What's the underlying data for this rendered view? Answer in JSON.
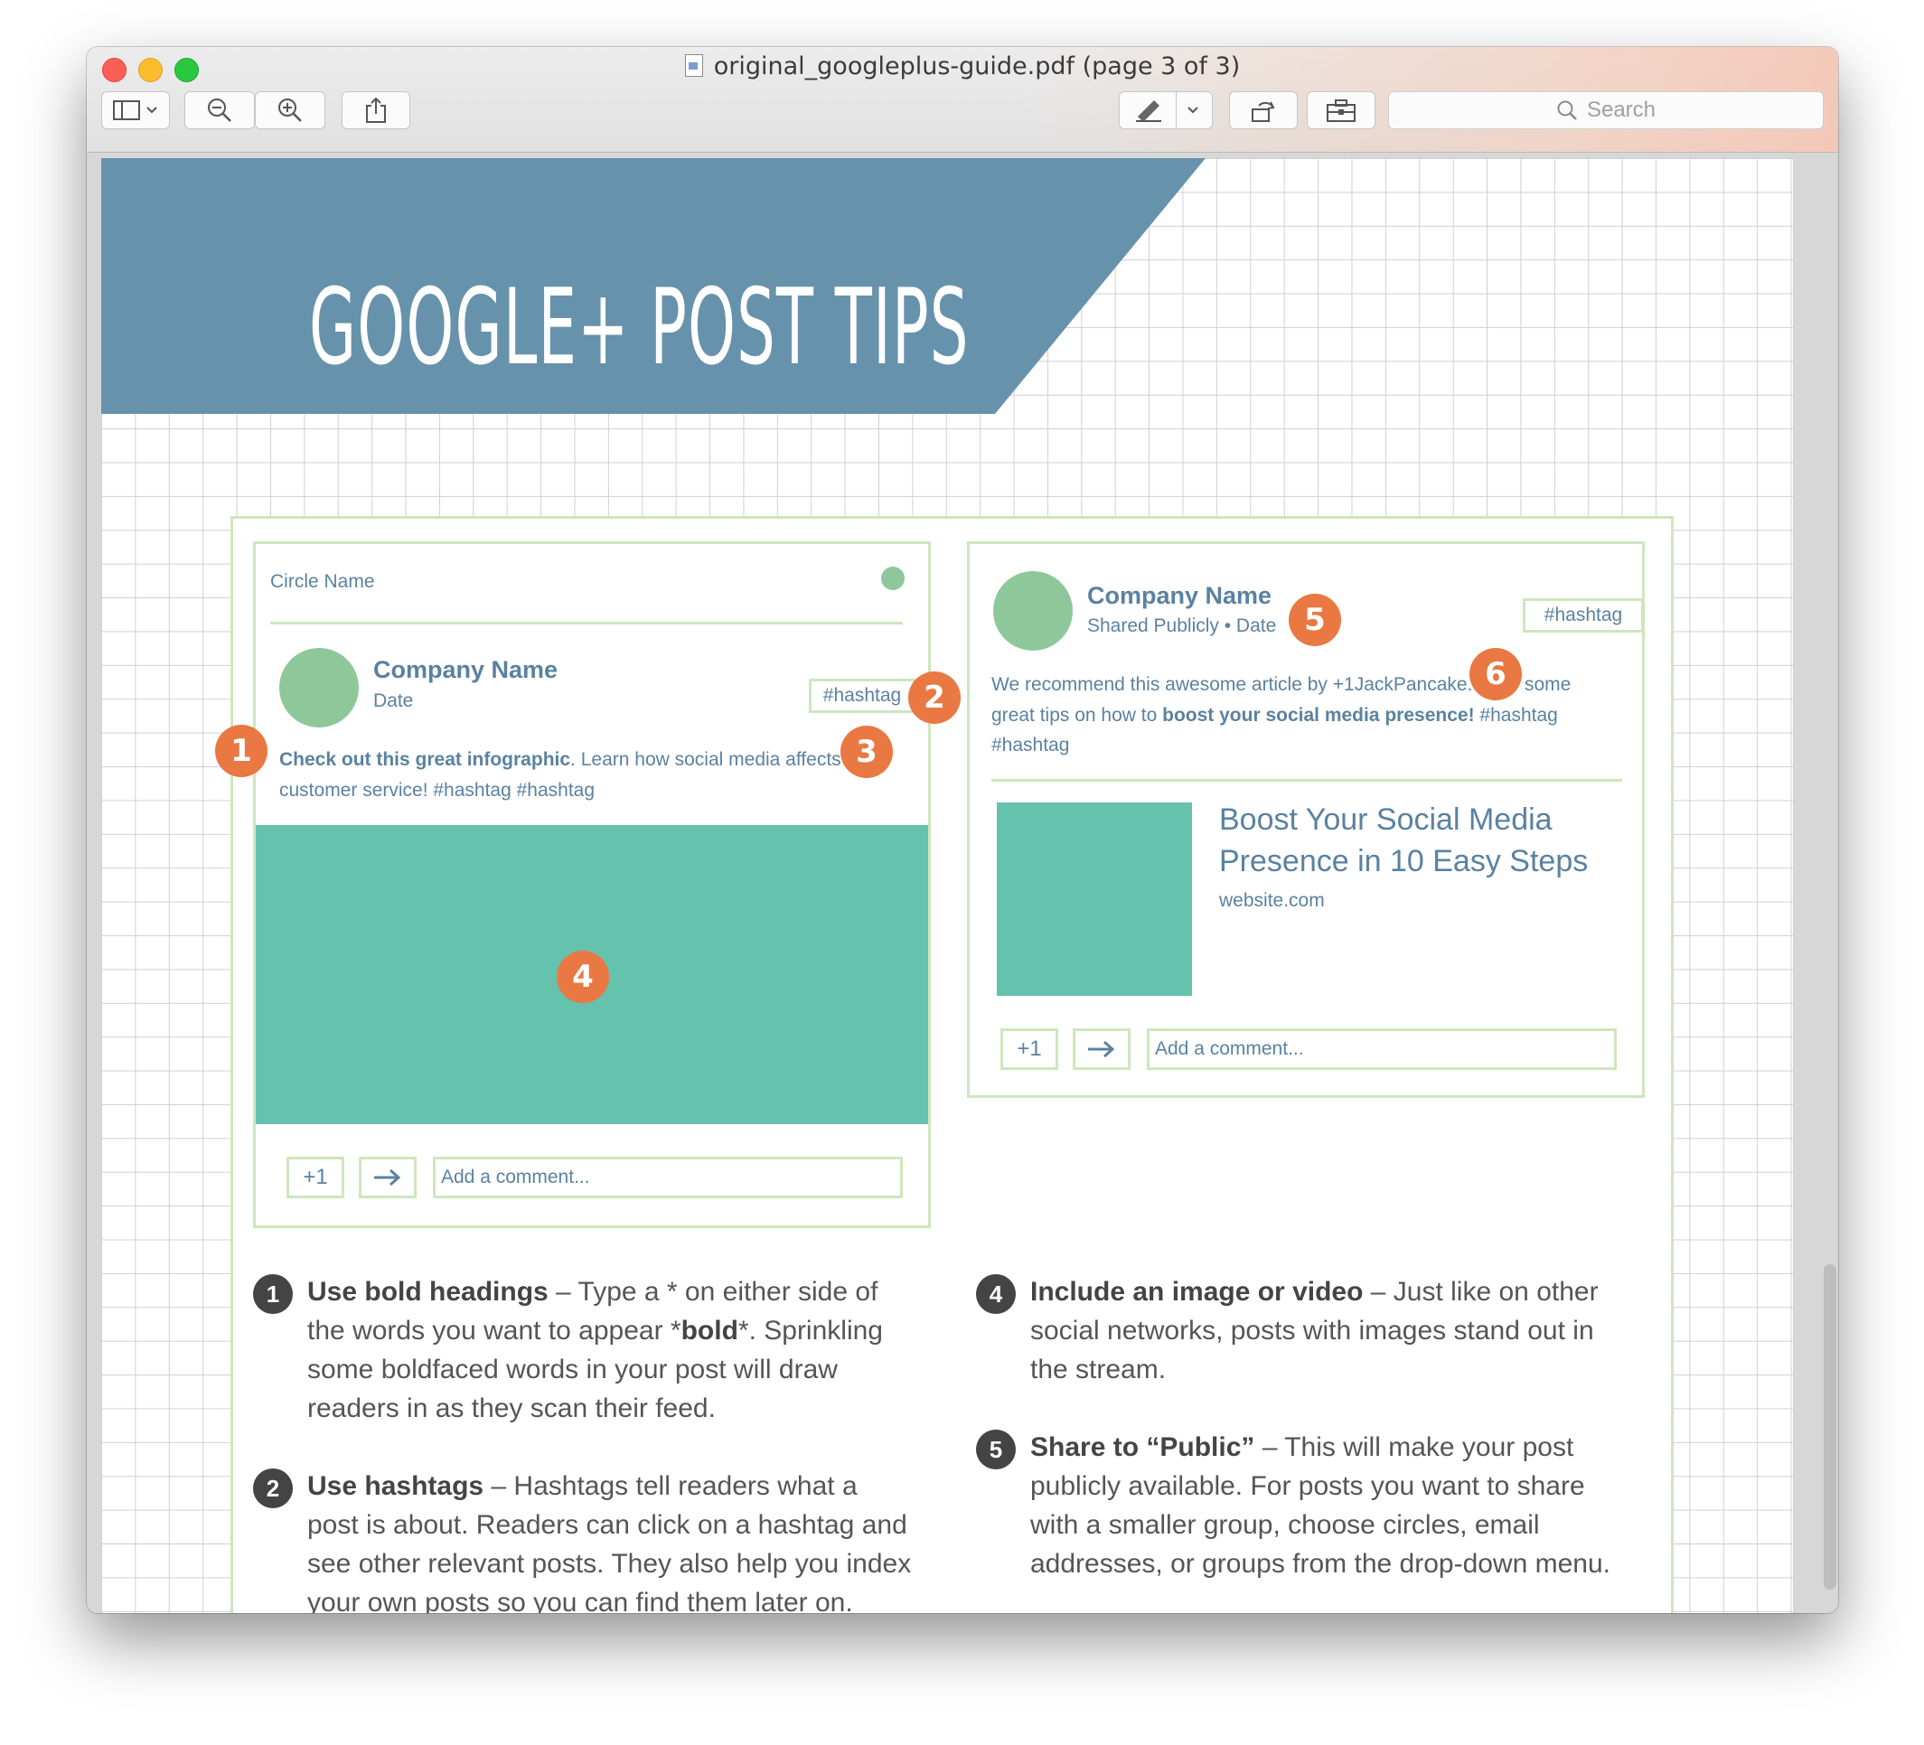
{
  "window": {
    "title": "original_googleplus-guide.pdf (page 3 of 3)",
    "search_placeholder": "Search"
  },
  "colors": {
    "banner": "#6792ac",
    "accent_text": "#5a82a0",
    "card_border": "#cfe6bd",
    "avatar": "#8ec89a",
    "media": "#64c2ad",
    "badge": "#ea7842"
  },
  "toolbar_icons": [
    "sidebar-icon",
    "chevron-down-icon",
    "zoom-out-icon",
    "zoom-in-icon",
    "share-icon",
    "markup-pen-icon",
    "rotate-icon",
    "toolbox-icon",
    "search-icon"
  ],
  "page": {
    "banner_title": "GOOGLE+ POST TIPS",
    "card1": {
      "circle_name": "Circle Name",
      "company": "Company Name",
      "date": "Date",
      "hashtag": "#hashtag",
      "text_bold": "Check out this great infographic",
      "text_line1_rest": ". Learn how social media affects",
      "text_line2": "customer service! #hashtag #hashtag",
      "plus_one": "+1",
      "comment_placeholder": "Add a comment..."
    },
    "card2": {
      "company": "Company Name",
      "shared": "Shared Publicly • Date",
      "hashtag": "#hashtag",
      "line1_a": "We recommend this awesome article by +1JackPancake.",
      "line1_b": "some",
      "line2_a": "great tips on how to ",
      "line2_bold": "boost your social media presence!",
      "line2_b": " #hashtag",
      "line3": "#hashtag",
      "link_title_1": "Boost Your Social Media",
      "link_title_2": "Presence in 10 Easy Steps",
      "link_domain": "website.com",
      "plus_one": "+1",
      "comment_placeholder": "Add a comment..."
    },
    "badges": [
      "1",
      "2",
      "3",
      "4",
      "5",
      "6"
    ],
    "tips": [
      {
        "num": "1",
        "bold": "Use bold headings",
        "text": " – Type a * on either side of the words you want to appear *",
        "bold2": "bold",
        "text2": "*. Sprinkling some boldfaced words in your post will draw readers in as they scan their feed."
      },
      {
        "num": "2",
        "bold": "Use hashtags",
        "text": " – Hashtags tell readers what a post is about. Readers can click on a hashtag and see other relevant posts. They also help you index your own posts so you can find them later on."
      },
      {
        "num": "4",
        "bold": "Include an image or video",
        "text": " – Just like on other social networks, posts with images stand out in the stream."
      },
      {
        "num": "5",
        "bold": "Share to “Public”",
        "text": " – This will make your post publicly available. For posts you want to share with a smaller group, choose circles, email addresses, or groups from the drop-down menu."
      }
    ]
  }
}
